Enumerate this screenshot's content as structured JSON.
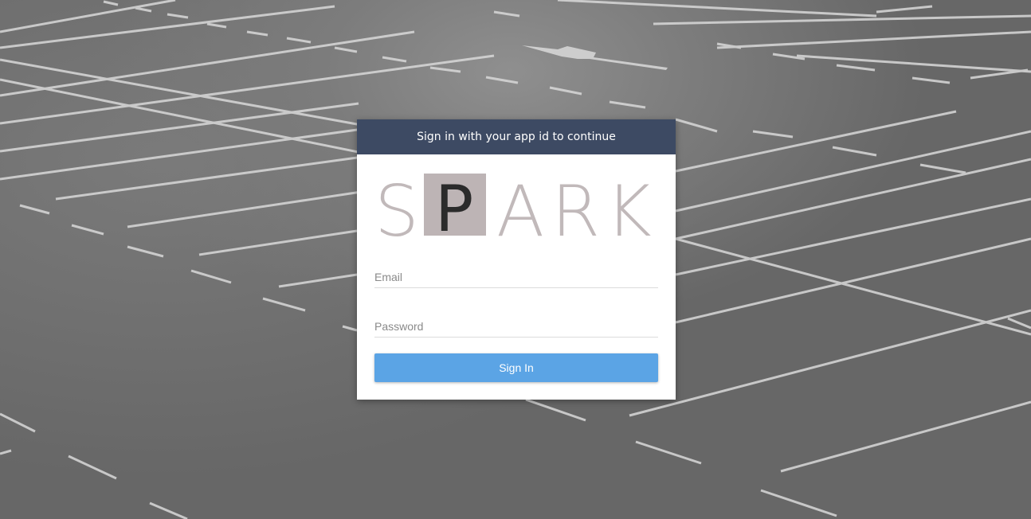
{
  "header": {
    "title": "Sign in with your app id to continue"
  },
  "logo": {
    "letters": [
      "S",
      "P",
      "A",
      "R",
      "K"
    ],
    "letter_color": "#c1b9ba",
    "highlight_bg": "#bdb4b5",
    "highlight_letter_color": "#2b2b2b"
  },
  "form": {
    "email_placeholder": "Email",
    "password_placeholder": "Password",
    "submit_label": "Sign In"
  },
  "colors": {
    "header_bg": "#3d4a63",
    "button_bg": "#5ba4e5",
    "background": "#676767"
  }
}
